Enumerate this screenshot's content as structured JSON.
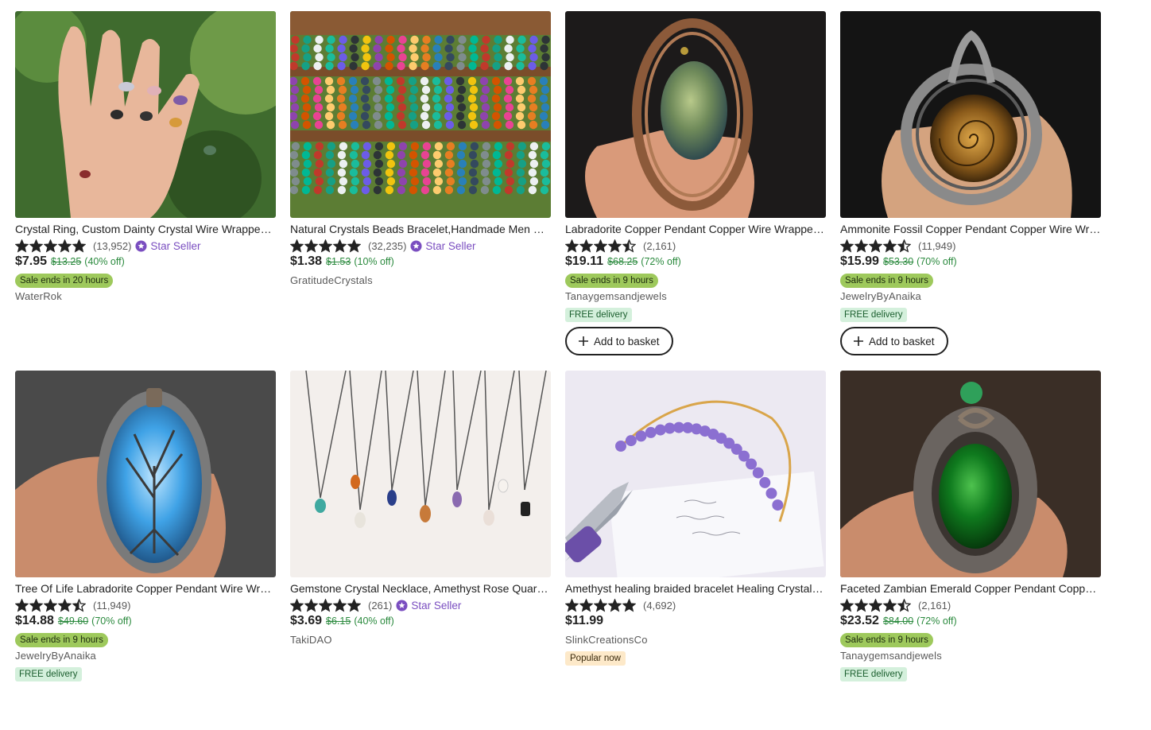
{
  "listings": [
    {
      "title": "Crystal Ring, Custom Dainty Crystal Wire Wrapped Ring",
      "stars": 5,
      "reviews": "(13,952)",
      "star_seller": "Star Seller",
      "price": "$7.95",
      "original_price": "$13.25",
      "discount": "(40% off)",
      "sale": "Sale ends in 20 hours",
      "shop": "WaterRok",
      "free_delivery": "",
      "popular": "",
      "add_to_basket": ""
    },
    {
      "title": "Natural Crystals Beads Bracelet,Handmade Men Women Bracelet",
      "stars": 5,
      "reviews": "(32,235)",
      "star_seller": "Star Seller",
      "price": "$1.38",
      "original_price": "$1.53",
      "discount": "(10% off)",
      "sale": "",
      "shop": "GratitudeCrystals",
      "free_delivery": "",
      "popular": "",
      "add_to_basket": ""
    },
    {
      "title": "Labradorite Copper Pendant Copper Wire Wrapped Pendant",
      "stars": 4.5,
      "reviews": "(2,161)",
      "star_seller": "",
      "price": "$19.11",
      "original_price": "$68.25",
      "discount": "(72% off)",
      "sale": "Sale ends in 9 hours",
      "shop": "Tanaygemsandjewels",
      "free_delivery": "FREE delivery",
      "popular": "",
      "add_to_basket": "Add to basket"
    },
    {
      "title": "Ammonite Fossil Copper Pendant Copper Wire Wrapped",
      "stars": 4.5,
      "reviews": "(11,949)",
      "star_seller": "",
      "price": "$15.99",
      "original_price": "$53.30",
      "discount": "(70% off)",
      "sale": "Sale ends in 9 hours",
      "shop": "JewelryByAnaika",
      "free_delivery": "FREE delivery",
      "popular": "",
      "add_to_basket": "Add to basket"
    },
    {
      "title": "Tree Of Life Labradorite Copper Pendant Wire Wrapped",
      "stars": 4.5,
      "reviews": "(11,949)",
      "star_seller": "",
      "price": "$14.88",
      "original_price": "$49.60",
      "discount": "(70% off)",
      "sale": "Sale ends in 9 hours",
      "shop": "JewelryByAnaika",
      "free_delivery": "FREE delivery",
      "popular": "",
      "add_to_basket": ""
    },
    {
      "title": "Gemstone Crystal Necklace, Amethyst Rose Quartz Necklace",
      "stars": 5,
      "reviews": "(261)",
      "star_seller": "Star Seller",
      "price": "$3.69",
      "original_price": "$6.15",
      "discount": "(40% off)",
      "sale": "",
      "shop": "TakiDAO",
      "free_delivery": "",
      "popular": "",
      "add_to_basket": ""
    },
    {
      "title": "Amethyst healing braided bracelet Healing Crystal Bracelet",
      "stars": 5,
      "reviews": "(4,692)",
      "star_seller": "",
      "price": "$11.99",
      "original_price": "",
      "discount": "",
      "sale": "",
      "shop": "SlinkCreationsCo",
      "free_delivery": "",
      "popular": "Popular now",
      "add_to_basket": ""
    },
    {
      "title": "Faceted Zambian Emerald Copper Pendant Copper Wire",
      "stars": 4.5,
      "reviews": "(2,161)",
      "star_seller": "",
      "price": "$23.52",
      "original_price": "$84.00",
      "discount": "(72% off)",
      "sale": "Sale ends in 9 hours",
      "shop": "Tanaygemsandjewels",
      "free_delivery": "FREE delivery",
      "popular": "",
      "add_to_basket": ""
    }
  ],
  "colors": {
    "star": "#222222",
    "star_seller": "#7a4ec0",
    "sale_badge": "#9ec95c",
    "discount_text": "#2b8a3e",
    "free_delivery_bg": "#d4f0dc",
    "popular_bg": "#fde9c9"
  }
}
